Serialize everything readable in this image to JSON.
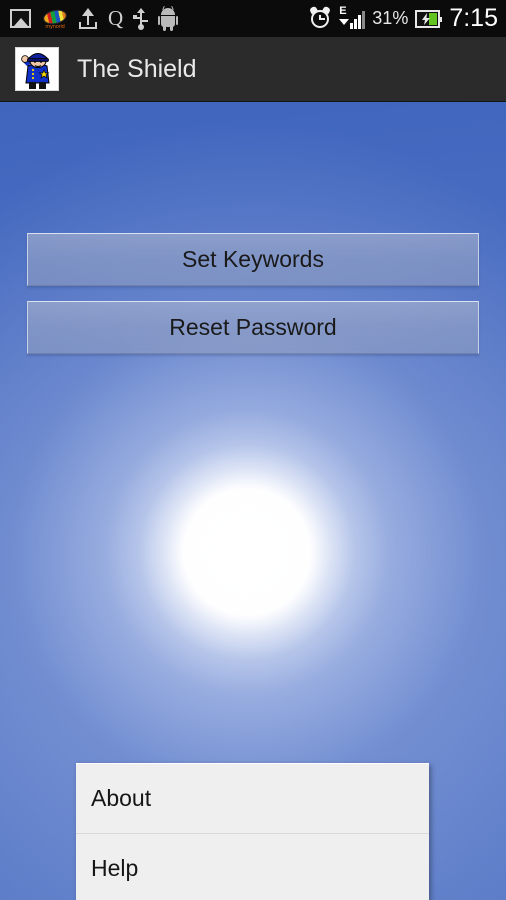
{
  "status_bar": {
    "left_icons": [
      {
        "name": "gallery-icon",
        "label": "Gallery"
      },
      {
        "name": "mynorid-icon",
        "label": "mynorid"
      },
      {
        "name": "upload-icon",
        "label": "Upload"
      },
      {
        "name": "q-icon",
        "label": "Q"
      },
      {
        "name": "usb-icon",
        "label": "USB connected"
      },
      {
        "name": "android-icon",
        "label": "Android system"
      }
    ],
    "alarm_icon": "alarm-clock-icon",
    "signal_network_type": "E",
    "signal_icon": "cellular-signal-icon",
    "battery_percent": "31%",
    "battery_icon": "battery-charging-icon",
    "clock": "7:15"
  },
  "action_bar": {
    "app_icon": "police-officer-icon",
    "title": "The Shield"
  },
  "main": {
    "buttons": [
      {
        "name": "set-keywords-button",
        "label": "Set Keywords"
      },
      {
        "name": "reset-password-button",
        "label": "Reset Password"
      }
    ],
    "wallpaper": "sun-glow-blue-sky"
  },
  "options_menu": {
    "items": [
      {
        "name": "menu-item-about",
        "label": "About"
      },
      {
        "name": "menu-item-help",
        "label": "Help"
      }
    ]
  },
  "colors": {
    "status_bar_bg": "#0b0b0b",
    "action_bar_bg": "#2b2b2b",
    "wallpaper_blue": "#4a6dc1",
    "menu_bg": "#efefef",
    "battery_green": "#62c421"
  }
}
